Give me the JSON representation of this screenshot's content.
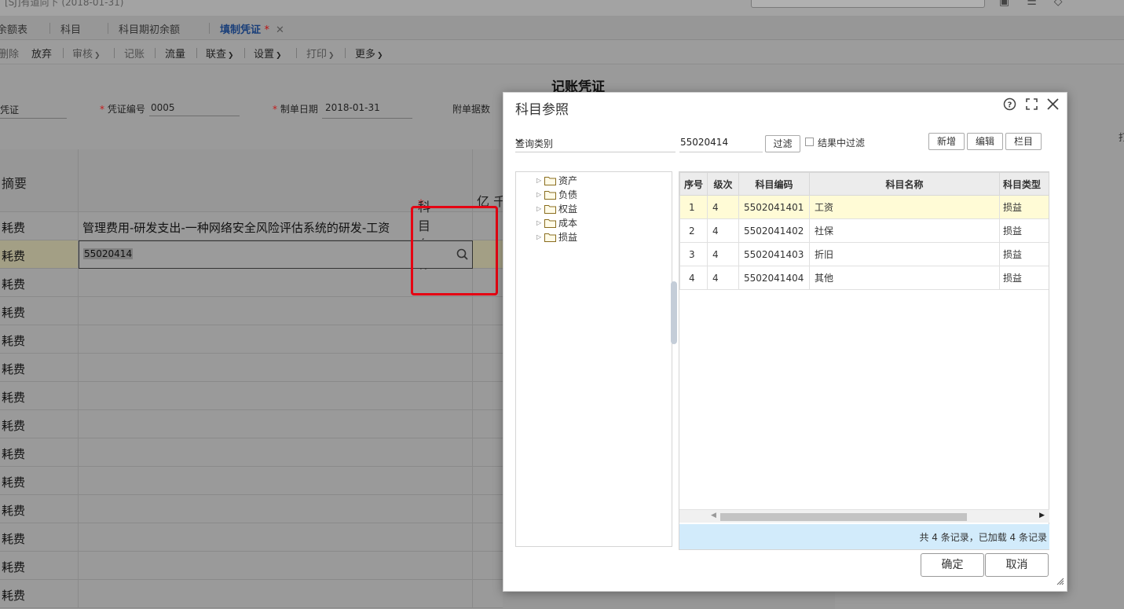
{
  "window": {
    "title": "[SJ]有道向下 (2018-01-31)"
  },
  "tabs": [
    {
      "label": "余额表"
    },
    {
      "label": "科目"
    },
    {
      "label": "科目期初余额"
    },
    {
      "label": "填制凭证",
      "modified": "*"
    }
  ],
  "toolbar": {
    "delete": "删除",
    "discard": "放弃",
    "review": "审核",
    "post": "记账",
    "flow": "流量",
    "linked": "联查",
    "settings": "设置",
    "print": "打印",
    "more": "更多"
  },
  "voucher": {
    "title": "记账凭证",
    "type_label": "凭证",
    "number_label": "凭证编号",
    "number_value": "0005",
    "date_label": "制单日期",
    "date_value": "2018-01-31",
    "attachments_label": "附单据数",
    "side_label": "打"
  },
  "grid": {
    "headers": {
      "summary": "摘要",
      "subject_name": "科目名称",
      "amount_units": "亿 千"
    },
    "rows": [
      {
        "summary": "耗费",
        "subject": "管理费用-研发支出-一种网络安全风险评估系统的研发-工资"
      },
      {
        "summary": "耗费",
        "subject_input": "55020414"
      },
      {
        "summary": "耗费",
        "subject": ""
      },
      {
        "summary": "耗费",
        "subject": ""
      },
      {
        "summary": "耗费",
        "subject": ""
      },
      {
        "summary": "耗费",
        "subject": ""
      },
      {
        "summary": "耗费",
        "subject": ""
      },
      {
        "summary": "耗费",
        "subject": ""
      },
      {
        "summary": "耗费",
        "subject": ""
      },
      {
        "summary": "耗费",
        "subject": ""
      },
      {
        "summary": "耗费",
        "subject": ""
      },
      {
        "summary": "耗费",
        "subject": ""
      },
      {
        "summary": "耗费",
        "subject": ""
      },
      {
        "summary": "耗费",
        "subject": ""
      }
    ]
  },
  "dialog": {
    "title": "科目参照",
    "query_type": "查询类别",
    "code_value": "55020414",
    "filter_button": "过滤",
    "filter_in_results": "结果中过滤",
    "new_button": "新增",
    "edit_button": "编辑",
    "columns_button": "栏目",
    "tree": [
      "资产",
      "负债",
      "权益",
      "成本",
      "损益"
    ],
    "table_headers": [
      "序号",
      "级次",
      "科目编码",
      "科目名称",
      "科目类型"
    ],
    "table_rows": [
      {
        "seq": "1",
        "level": "4",
        "code": "5502041401",
        "name": "工资",
        "type": "损益"
      },
      {
        "seq": "2",
        "level": "4",
        "code": "5502041402",
        "name": "社保",
        "type": "损益"
      },
      {
        "seq": "3",
        "level": "4",
        "code": "5502041403",
        "name": "折旧",
        "type": "损益"
      },
      {
        "seq": "4",
        "level": "4",
        "code": "5502041404",
        "name": "其他",
        "type": "损益"
      }
    ],
    "status": "共 4 条记录，已加载 4 条记录",
    "ok_button": "确定",
    "cancel_button": "取消"
  }
}
